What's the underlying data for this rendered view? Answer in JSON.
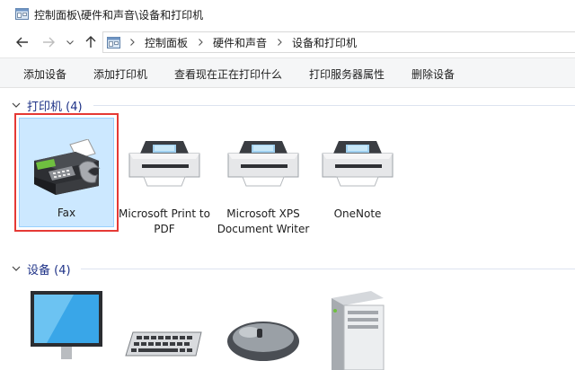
{
  "window": {
    "title": "控制面板\\硬件和声音\\设备和打印机"
  },
  "address": {
    "crumbs": [
      "控制面板",
      "硬件和声音",
      "设备和打印机"
    ]
  },
  "toolbar": {
    "items": [
      "添加设备",
      "添加打印机",
      "查看现在正在打印什么",
      "打印服务器属性",
      "删除设备"
    ]
  },
  "groups": {
    "printers": {
      "label": "打印机 (4)",
      "items": [
        {
          "name": "Fax",
          "icon": "fax-icon",
          "selected": true
        },
        {
          "name": "Microsoft Print to PDF",
          "icon": "printer-icon"
        },
        {
          "name": "Microsoft XPS Document Writer",
          "icon": "printer-icon"
        },
        {
          "name": "OneNote",
          "icon": "printer-icon"
        }
      ]
    },
    "devices": {
      "label": "设备 (4)",
      "items": [
        {
          "icon": "monitor-icon"
        },
        {
          "icon": "keyboard-icon"
        },
        {
          "icon": "mouse-icon"
        },
        {
          "icon": "computer-tower-icon"
        }
      ]
    }
  },
  "colors": {
    "selection_fill": "#cce8ff",
    "selection_border": "#99d1ff",
    "highlight_frame": "#e53935",
    "group_label": "#1e3287"
  }
}
